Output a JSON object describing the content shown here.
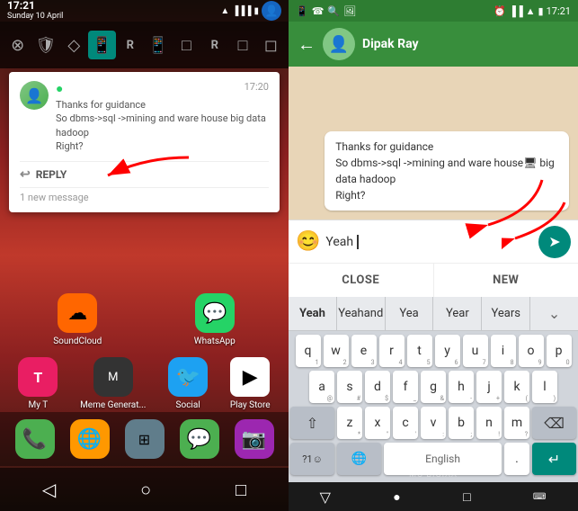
{
  "left": {
    "status_bar": {
      "time": "17:21",
      "date": "Sunday 10 April"
    },
    "top_icons": [
      "⊗",
      "🛡",
      "◇",
      "📱",
      "R",
      "📱",
      "□",
      "R",
      "□",
      "◻"
    ],
    "notification": {
      "sender": "",
      "time": "17:20",
      "message_line1": "Thanks for guidance",
      "message_line2": "So dbms->sql ->mining and ware house",
      "message_line3": "big data hadoop",
      "message_line4": "Right?",
      "reply_label": "REPLY",
      "new_message": "1 new message"
    },
    "home_icons": [
      {
        "label": "SoundCloud",
        "bg": "#f60",
        "icon": "☁"
      },
      {
        "label": "WhatsApp",
        "bg": "#25d366",
        "icon": "📱"
      }
    ],
    "home_icons_row2": [
      {
        "label": "My T",
        "bg": "#e91e63",
        "icon": "T"
      },
      {
        "label": "Meme Generat...",
        "bg": "#333",
        "icon": "M"
      },
      {
        "label": "Social",
        "bg": "#1da1f2",
        "icon": "🐦"
      },
      {
        "label": "Play Store",
        "bg": "#fff",
        "icon": "▶"
      }
    ],
    "dock_icons": [
      {
        "label": "",
        "icon": "📞",
        "bg": "#4caf50"
      },
      {
        "label": "",
        "icon": "🌐",
        "bg": "#ff9800"
      },
      {
        "label": "",
        "icon": "⊞",
        "bg": "#2196f3"
      },
      {
        "label": "",
        "icon": "💬",
        "bg": "#4caf50"
      },
      {
        "label": "",
        "icon": "📷",
        "bg": "#9c27b0"
      }
    ],
    "nav_buttons": [
      "◁",
      "○",
      "□"
    ]
  },
  "right": {
    "status_bar": {
      "left_icons": [
        "📱",
        "☎",
        "🔍",
        "📷"
      ],
      "time": "17:21",
      "right_icons": [
        "🔔",
        "📶",
        "🔋"
      ]
    },
    "chat_header": {
      "name": "Dipak Ray"
    },
    "chat_bubble": {
      "line1": "Thanks for guidance",
      "line2": "So dbms->sql ->mining and ware house🖥 big data hadoop",
      "line3": "Right?"
    },
    "reply_input": {
      "emoji_icon": "😊",
      "value": "Yeah",
      "cursor": "|"
    },
    "send_btn": "➤",
    "action_buttons": [
      "CLOSE",
      "NEW"
    ],
    "suggestions": [
      "Yeah",
      "Yeahand",
      "Yea",
      "Year",
      "Years"
    ],
    "keyboard": {
      "row1": [
        {
          "label": "q",
          "sub": "1"
        },
        {
          "label": "w",
          "sub": "2"
        },
        {
          "label": "e",
          "sub": "3"
        },
        {
          "label": "r",
          "sub": "4"
        },
        {
          "label": "t",
          "sub": "5"
        },
        {
          "label": "y",
          "sub": "6"
        },
        {
          "label": "u",
          "sub": "7"
        },
        {
          "label": "i",
          "sub": "8"
        },
        {
          "label": "o",
          "sub": "9"
        },
        {
          "label": "p",
          "sub": "0"
        }
      ],
      "row2": [
        {
          "label": "a",
          "sub": "@"
        },
        {
          "label": "s",
          "sub": "#"
        },
        {
          "label": "d",
          "sub": "$"
        },
        {
          "label": "f",
          "sub": "_"
        },
        {
          "label": "g",
          "sub": "&"
        },
        {
          "label": "h",
          "sub": "-"
        },
        {
          "label": "j",
          "sub": "+"
        },
        {
          "label": "k",
          "sub": "("
        },
        {
          "label": "l",
          "sub": ")"
        }
      ],
      "row3": [
        {
          "label": "⇧",
          "special": true
        },
        {
          "label": "z",
          "sub": "*"
        },
        {
          "label": "x",
          "sub": "\""
        },
        {
          "label": "c",
          "sub": "'"
        },
        {
          "label": "v",
          "sub": ":"
        },
        {
          "label": "b",
          "sub": ";"
        },
        {
          "label": "n",
          "sub": "!"
        },
        {
          "label": "m",
          "sub": "?"
        },
        {
          "label": "⌫",
          "delete": true
        }
      ],
      "row4_sym": "?1☺",
      "row4_globe": "🌐",
      "row4_space": "English",
      "row4_dot": ".",
      "row4_enter": "↵"
    },
    "bottom_nav": [
      "▽",
      "●",
      "□"
    ],
    "watermark": "MO BIGIAA"
  }
}
